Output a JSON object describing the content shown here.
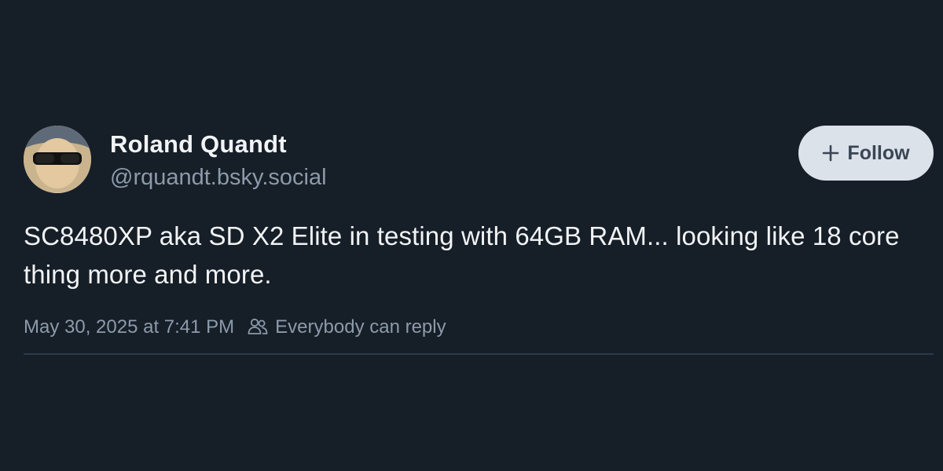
{
  "post": {
    "author": {
      "display_name": "Roland Quandt",
      "handle": "@rquandt.bsky.social"
    },
    "follow_button": {
      "label": "Follow",
      "icon": "plus-icon"
    },
    "text": "SC8480XP aka SD X2 Elite in testing with 64GB RAM... looking like 18 core thing more and more.",
    "timestamp": "May 30, 2025 at 7:41 PM",
    "reply_setting": {
      "label": "Everybody can reply",
      "icon": "people-icon"
    }
  },
  "colors": {
    "background": "#161e27",
    "text_primary": "#f1f3f5",
    "text_secondary": "#8c9aab",
    "follow_bg": "#dce2ea",
    "divider": "#2b3a4a"
  }
}
